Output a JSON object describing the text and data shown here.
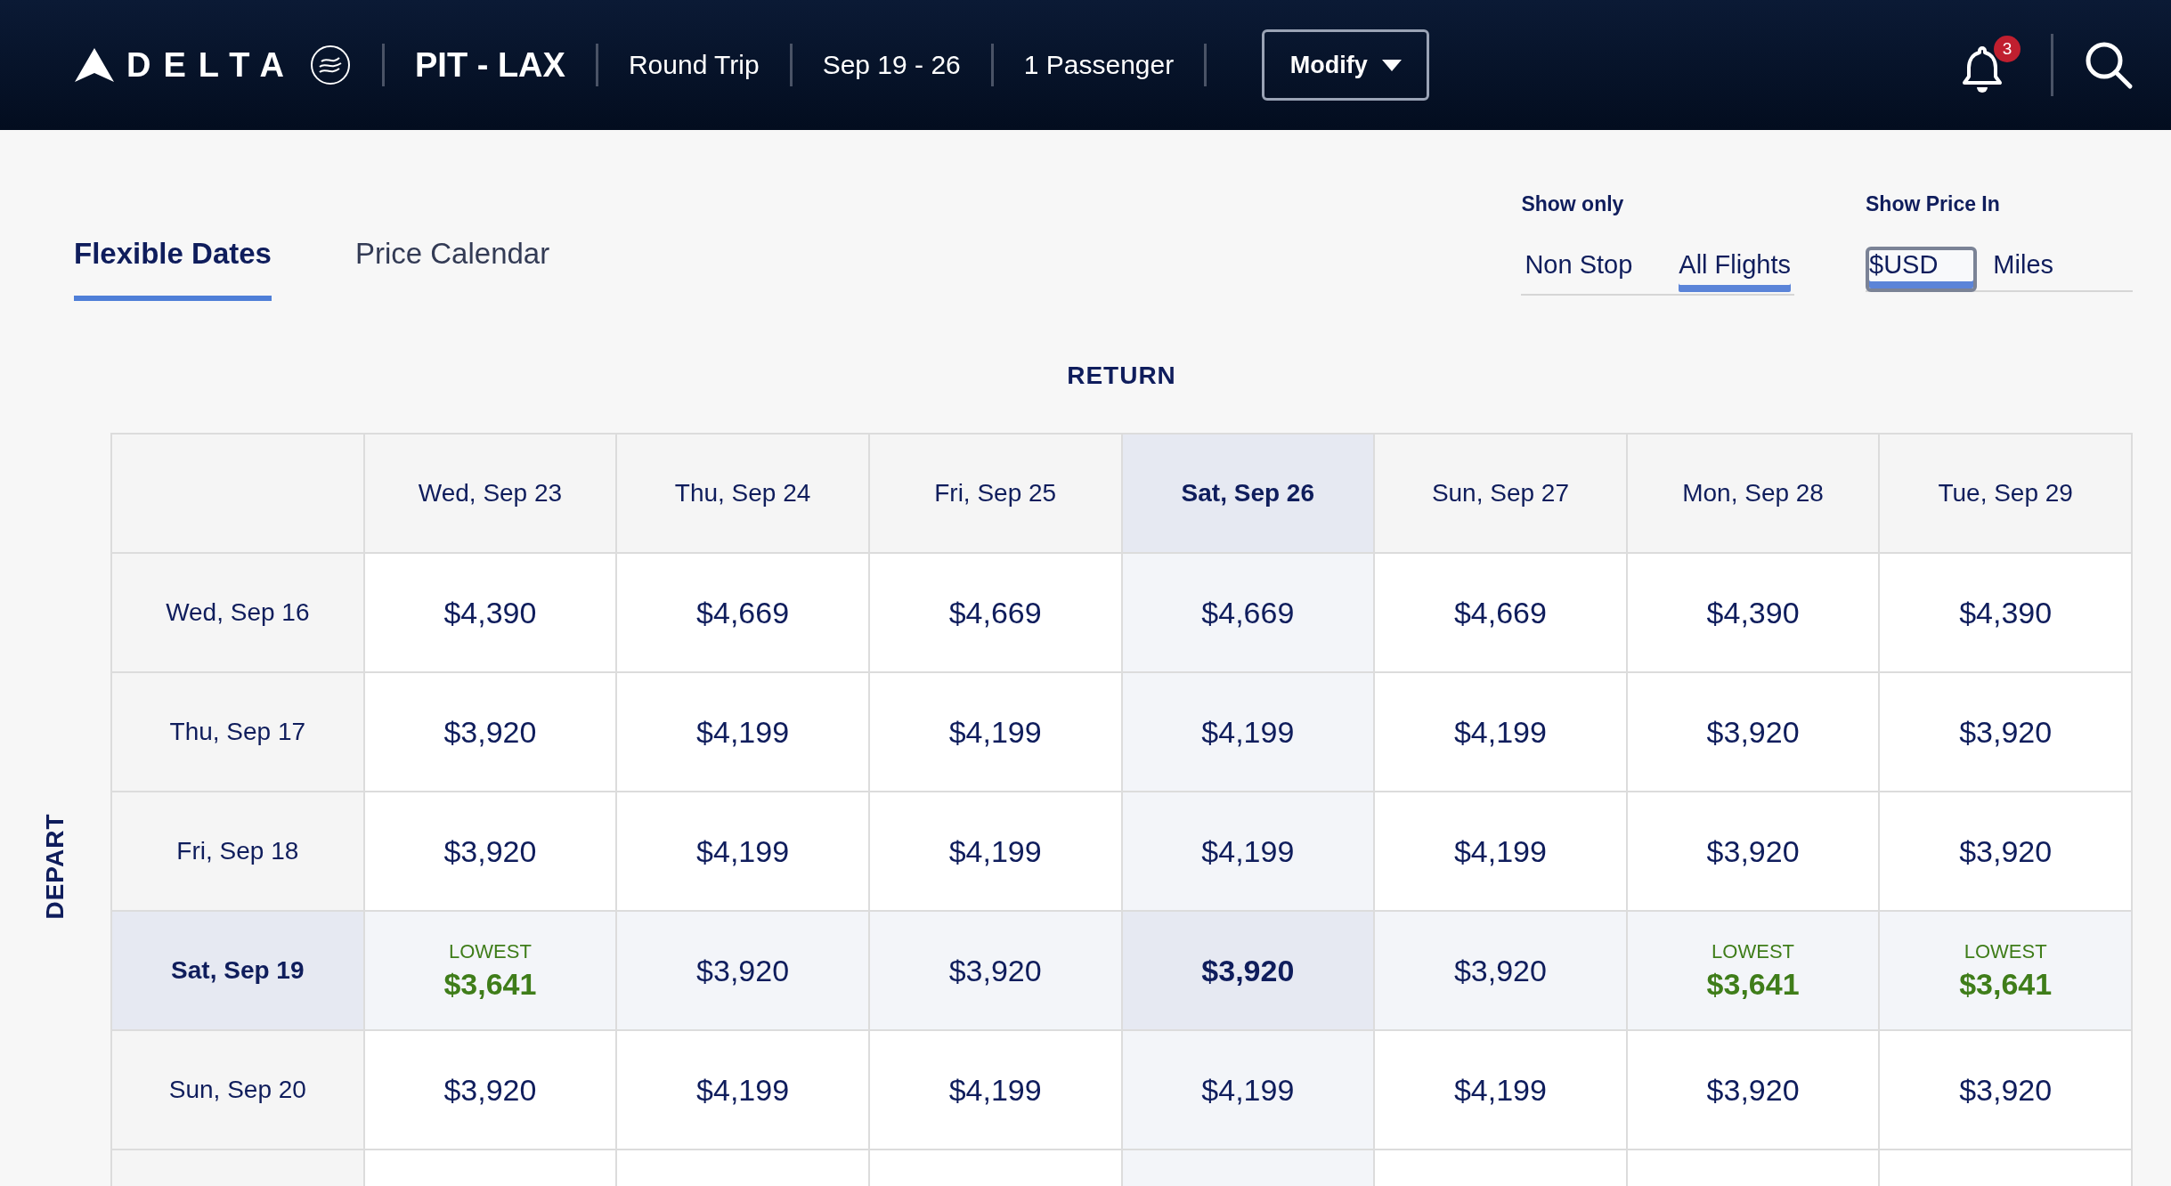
{
  "header": {
    "brand": "DELTA",
    "route": "PIT - LAX",
    "trip_type": "Round Trip",
    "dates": "Sep 19 - 26",
    "passengers": "1 Passenger",
    "modify_button": "Modify",
    "notification_count": "3"
  },
  "view_tabs": [
    {
      "label": "Flexible Dates",
      "selected": true
    },
    {
      "label": "Price Calendar",
      "selected": false
    }
  ],
  "show_only": {
    "title": "Show only",
    "options": [
      {
        "label": "Non Stop",
        "selected": false
      },
      {
        "label": "All Flights",
        "selected": true
      }
    ]
  },
  "show_price_in": {
    "title": "Show Price In",
    "options": [
      {
        "label": "$USD",
        "selected": true
      },
      {
        "label": "Miles",
        "selected": false
      }
    ]
  },
  "grid": {
    "return_label": "RETURN",
    "depart_label": "DEPART",
    "columns": [
      {
        "label": "Wed, Sep 23",
        "selected": false
      },
      {
        "label": "Thu, Sep 24",
        "selected": false
      },
      {
        "label": "Fri, Sep 25",
        "selected": false
      },
      {
        "label": "Sat, Sep 26",
        "selected": true
      },
      {
        "label": "Sun, Sep 27",
        "selected": false
      },
      {
        "label": "Mon, Sep 28",
        "selected": false
      },
      {
        "label": "Tue, Sep 29",
        "selected": false
      }
    ],
    "rows": [
      {
        "label": "Wed, Sep 16",
        "selected": false,
        "cells": [
          {
            "kind": "regular",
            "price": "$4,390"
          },
          {
            "kind": "regular",
            "price": "$4,669"
          },
          {
            "kind": "regular",
            "price": "$4,669"
          },
          {
            "kind": "regular",
            "price": "$4,669"
          },
          {
            "kind": "regular",
            "price": "$4,669"
          },
          {
            "kind": "regular",
            "price": "$4,390"
          },
          {
            "kind": "regular",
            "price": "$4,390"
          }
        ]
      },
      {
        "label": "Thu, Sep 17",
        "selected": false,
        "cells": [
          {
            "kind": "regular",
            "price": "$3,920"
          },
          {
            "kind": "regular",
            "price": "$4,199"
          },
          {
            "kind": "regular",
            "price": "$4,199"
          },
          {
            "kind": "regular",
            "price": "$4,199"
          },
          {
            "kind": "regular",
            "price": "$4,199"
          },
          {
            "kind": "regular",
            "price": "$3,920"
          },
          {
            "kind": "regular",
            "price": "$3,920"
          }
        ]
      },
      {
        "label": "Fri, Sep 18",
        "selected": false,
        "cells": [
          {
            "kind": "regular",
            "price": "$3,920"
          },
          {
            "kind": "regular",
            "price": "$4,199"
          },
          {
            "kind": "regular",
            "price": "$4,199"
          },
          {
            "kind": "regular",
            "price": "$4,199"
          },
          {
            "kind": "regular",
            "price": "$4,199"
          },
          {
            "kind": "regular",
            "price": "$3,920"
          },
          {
            "kind": "regular",
            "price": "$3,920"
          }
        ]
      },
      {
        "label": "Sat, Sep 19",
        "selected": true,
        "cells": [
          {
            "kind": "lowest",
            "badge": "LOWEST",
            "price": "$3,641"
          },
          {
            "kind": "regular",
            "price": "$3,920"
          },
          {
            "kind": "regular",
            "price": "$3,920"
          },
          {
            "kind": "regular",
            "price": "$3,920"
          },
          {
            "kind": "regular",
            "price": "$3,920"
          },
          {
            "kind": "lowest",
            "badge": "LOWEST",
            "price": "$3,641"
          },
          {
            "kind": "lowest",
            "badge": "LOWEST",
            "price": "$3,641"
          }
        ]
      },
      {
        "label": "Sun, Sep 20",
        "selected": false,
        "cells": [
          {
            "kind": "regular",
            "price": "$3,920"
          },
          {
            "kind": "regular",
            "price": "$4,199"
          },
          {
            "kind": "regular",
            "price": "$4,199"
          },
          {
            "kind": "regular",
            "price": "$4,199"
          },
          {
            "kind": "regular",
            "price": "$4,199"
          },
          {
            "kind": "regular",
            "price": "$3,920"
          },
          {
            "kind": "regular",
            "price": "$3,920"
          }
        ]
      }
    ]
  }
}
